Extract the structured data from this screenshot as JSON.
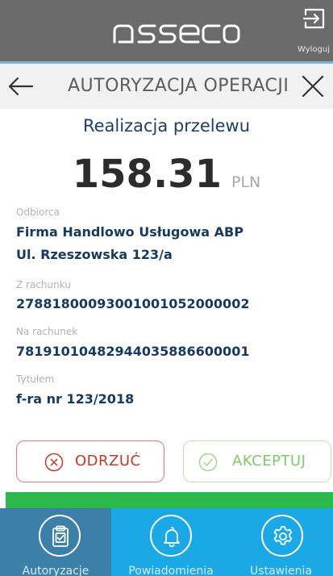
{
  "app": {
    "brand": "asseco",
    "logout_label": "Wyloguj"
  },
  "header": {
    "title": "AUTORYZACJA OPERACJI"
  },
  "operation": {
    "title": "Realizacja przelewu",
    "amount": "158.31",
    "currency": "PLN"
  },
  "fields": {
    "recipient_label": "Odbiorca",
    "recipient_name": "Firma Handlowo Usługowa ABP",
    "recipient_address": "Ul. Rzeszowska 123/a",
    "from_account_label": "Z rachunku",
    "from_account": "27881800093001001052000002",
    "to_account_label": "Na rachunek",
    "to_account": "78191010482944035886600001",
    "title_label": "Tytułem",
    "title_value": "f-ra nr 123/2018"
  },
  "actions": {
    "reject_label": "ODRZUĆ",
    "accept_label": "AKCEPTUJ"
  },
  "tabs": [
    {
      "label": "Autoryzacje",
      "icon": "clipboard-check-icon"
    },
    {
      "label": "Powiadomienia",
      "icon": "bell-icon"
    },
    {
      "label": "Ustawienia",
      "icon": "gear-icon"
    }
  ],
  "colors": {
    "topbar": "#6b6b6b",
    "primary_text": "#163a5f",
    "reject": "#c0392b",
    "accept": "#7fc86c",
    "status_bar": "#2db84e",
    "tabbar": "#1aa9e6",
    "tab_active": "#3c7fa8"
  }
}
